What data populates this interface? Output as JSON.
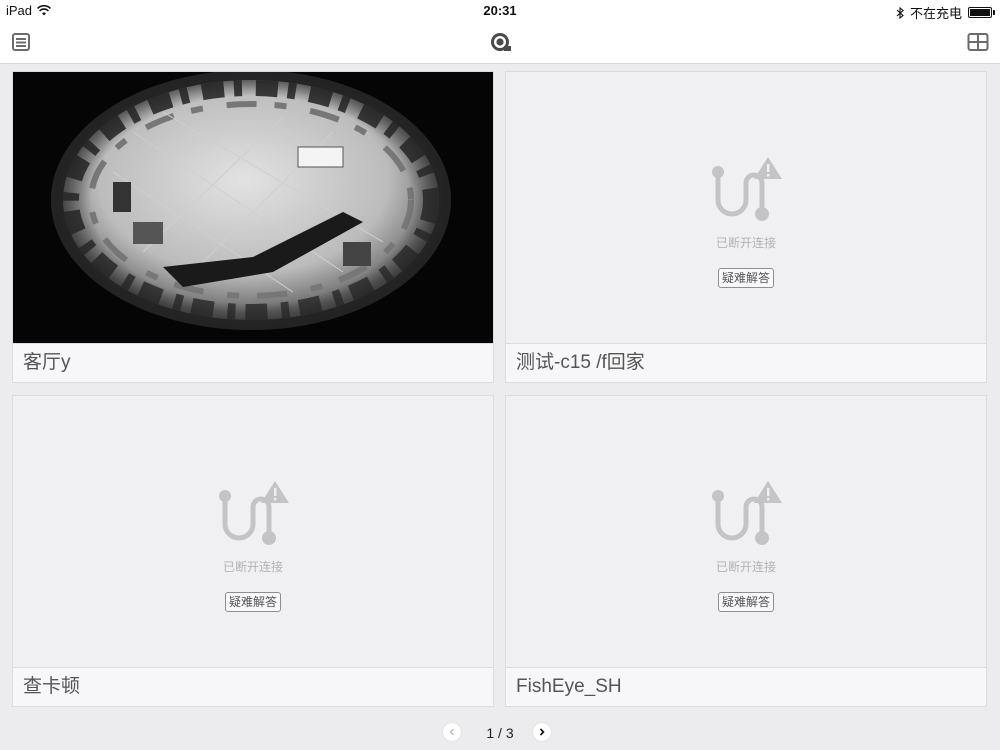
{
  "status_bar": {
    "device": "iPad",
    "time": "20:31",
    "charging_status": "不在充电",
    "icons": [
      "wifi-icon",
      "bluetooth-icon",
      "battery-icon"
    ]
  },
  "nav": {
    "left_icon": "menu-list-icon",
    "center_icon": "app-logo-icon",
    "right_icon": "grid-layout-icon"
  },
  "cameras": [
    {
      "name": "客厅y",
      "state": "live"
    },
    {
      "name": "测试-c15 /f回家",
      "state": "offline",
      "status_text": "已断开连接",
      "help_label": "疑难解答"
    },
    {
      "name": "查卡顿",
      "state": "offline",
      "status_text": "已断开连接",
      "help_label": "疑难解答"
    },
    {
      "name": "FishEye_SH",
      "state": "offline",
      "status_text": "已断开连接",
      "help_label": "疑难解答"
    }
  ],
  "pager": {
    "text": "1 / 3",
    "prev_icon": "chevron-left-icon",
    "next_icon": "chevron-right-icon"
  },
  "colors": {
    "background": "#ececee",
    "icon_gray": "#c4c4c6",
    "text_gray": "#555555"
  }
}
